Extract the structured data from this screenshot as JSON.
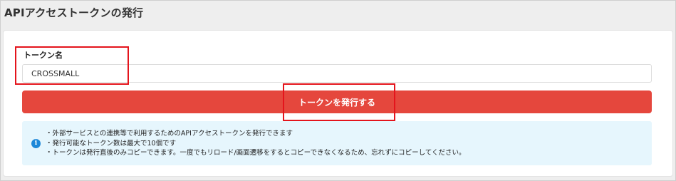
{
  "page": {
    "title": "APIアクセストークンの発行"
  },
  "form": {
    "token_name_label": "トークン名",
    "token_name_value": "CROSSMALL",
    "submit_label": "トークンを発行する"
  },
  "info": {
    "icon": "info-icon",
    "notes": [
      "・外部サービスとの連携等で利用するためのAPIアクセストークンを発行できます",
      "・発行可能なトークン数は最大で10個です",
      "・トークンは発行直後のみコピーできます。一度でもリロード/画面遷移をするとコピーできなくなるため、忘れずにコピーしてください。"
    ]
  },
  "colors": {
    "accent_button": "#e5473d",
    "info_background": "#e6f6fd",
    "info_icon": "#1e88d8",
    "annotation": "#e4141c"
  }
}
